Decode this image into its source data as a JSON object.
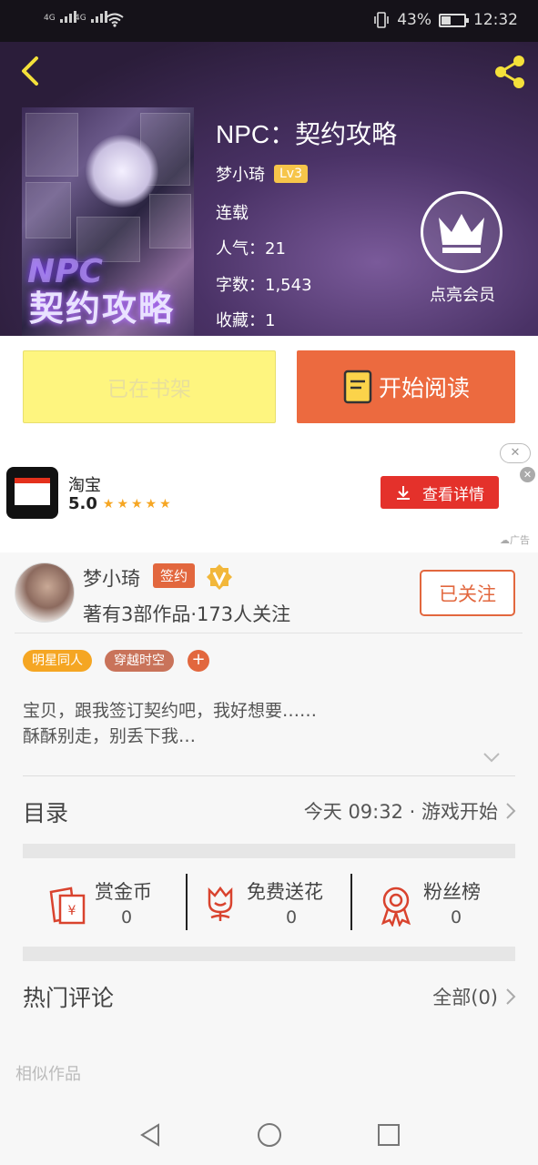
{
  "status_bar": {
    "sim1": "4G",
    "sim2": "4G",
    "battery": "43%",
    "battery_level": 0.43,
    "time": "12:32"
  },
  "book": {
    "cover_text": "契约攻略",
    "title": "NPC：契约攻略",
    "author": "梦小琦",
    "author_level": "Lv3",
    "status": "连载",
    "popularity": "人气：21",
    "word_count": "字数：1,543",
    "favorites": "收藏：1"
  },
  "vip": {
    "label": "点亮会员"
  },
  "actions": {
    "shelf_label": "已在书架",
    "read_label": "开始阅读"
  },
  "ad": {
    "app_name": "淘宝",
    "rating": "5.0",
    "stars": "★★★★★",
    "button_label": "查看详情",
    "close": "✕",
    "tag": "广告"
  },
  "author_card": {
    "name": "梦小琦",
    "sign_badge": "签约",
    "stats": "著有3部作品·173人关注",
    "follow_label": "已关注",
    "tags": [
      "明星同人",
      "穿越时空"
    ],
    "tag_colors": [
      "#f5a623",
      "#c9735a"
    ],
    "add_tag": "+"
  },
  "intro": {
    "line1": "宝贝，跟我签订契约吧，我好想要……",
    "line2": "酥酥别走，别丢下我…"
  },
  "toc": {
    "title": "目录",
    "latest": "今天 09:32 · 游戏开始"
  },
  "stats": [
    {
      "label": "赏金币",
      "value": "0"
    },
    {
      "label": "免费送花",
      "value": "0"
    },
    {
      "label": "粉丝榜",
      "value": "0"
    }
  ],
  "comments": {
    "title": "热门评论",
    "all_label": "全部(0)"
  },
  "similar": {
    "title": "相似作品"
  },
  "colors": {
    "accent_orange": "#ec6a3f",
    "shelf_yellow": "#fef57f",
    "ad_red": "#e4312b",
    "share_yellow": "#f4e03a"
  }
}
